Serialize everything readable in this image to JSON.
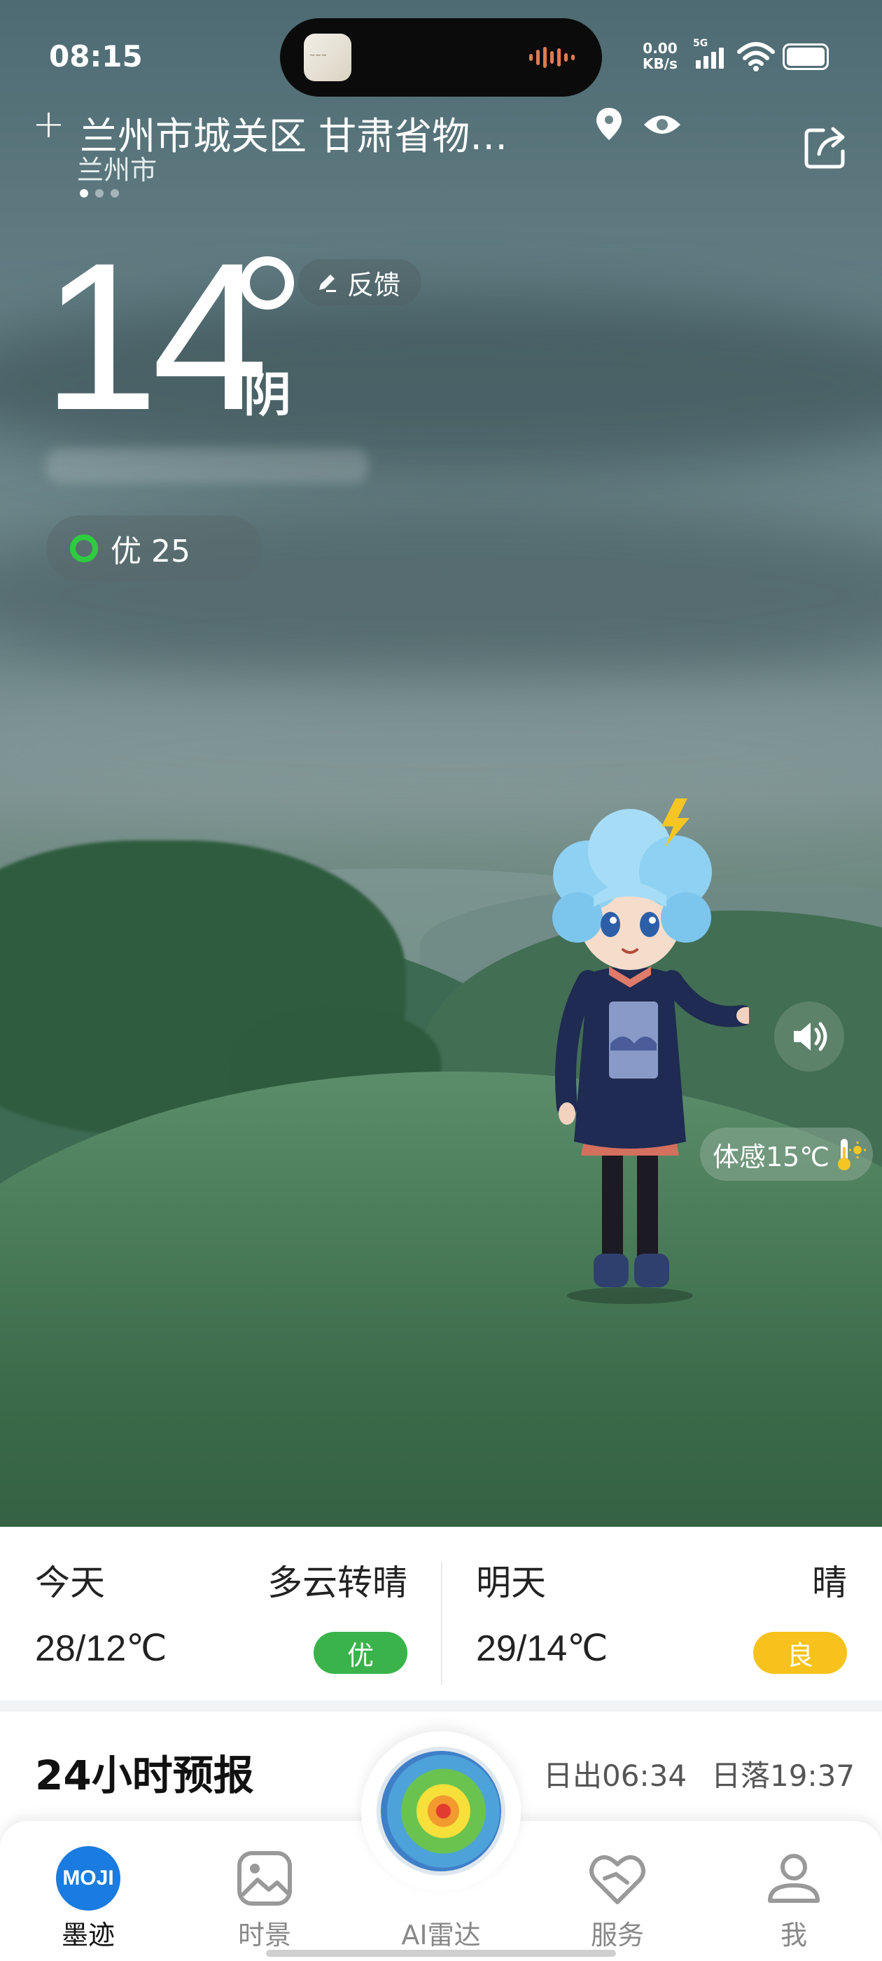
{
  "status_bar": {
    "time": "08:15",
    "net_speed": "0.00",
    "net_unit": "KB/s",
    "signal": "5G"
  },
  "location": {
    "title": "兰州市城关区 甘肃省物…",
    "city": "兰州市",
    "pages": 3,
    "current_page": 1
  },
  "current": {
    "temperature": "14",
    "condition": "阴",
    "feedback_label": "反馈",
    "aqi_label": "优 25",
    "feels_like": "体感15℃"
  },
  "daily": [
    {
      "label": "今天",
      "condition": "多云转晴",
      "temps": "28/12℃",
      "aqi": "优",
      "aqi_color": "#3ab34a"
    },
    {
      "label": "明天",
      "condition": "晴",
      "temps": "29/14℃",
      "aqi": "良",
      "aqi_color": "#f7c21b"
    }
  ],
  "hourly": {
    "title": "24小时预报",
    "sunrise": "日出06:34",
    "sunset": "日落19:37"
  },
  "tabs": [
    {
      "label": "墨迹",
      "icon": "moji-logo",
      "active": true
    },
    {
      "label": "时景",
      "icon": "image-icon",
      "active": false
    },
    {
      "label": "AI雷达",
      "icon": "radar-icon",
      "active": false
    },
    {
      "label": "服务",
      "icon": "service-heart-icon",
      "active": false
    },
    {
      "label": "我",
      "icon": "person-icon",
      "active": false
    }
  ],
  "moji_logo_text": "MOJI"
}
